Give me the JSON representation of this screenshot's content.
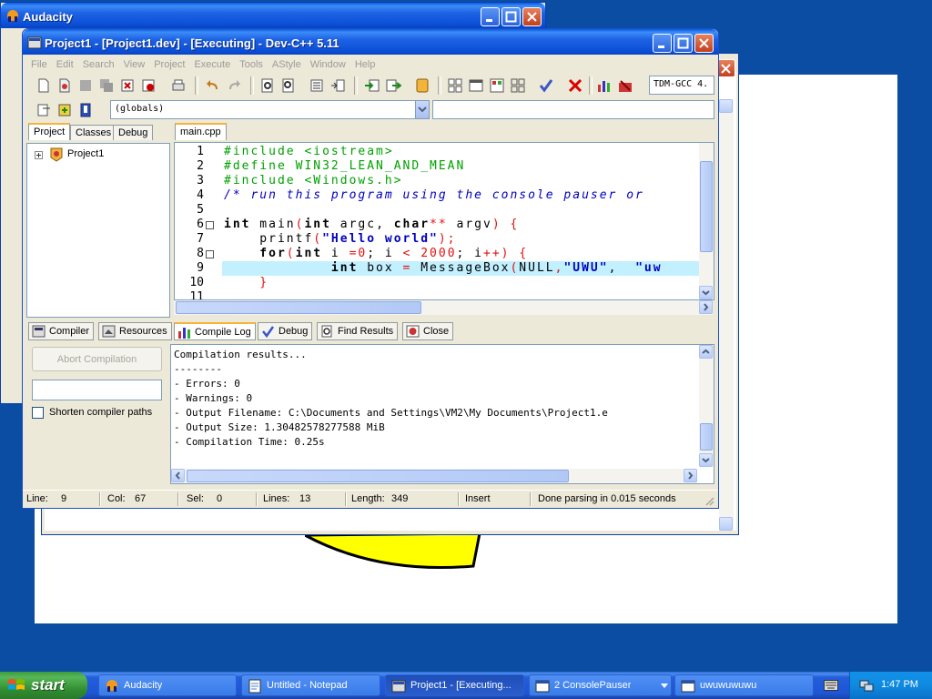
{
  "audacity": {
    "title": "Audacity"
  },
  "devcpp": {
    "title": "Project1 - [Project1.dev] - [Executing] - Dev-C++ 5.11",
    "menu": [
      "File",
      "Edit",
      "Search",
      "View",
      "Project",
      "Execute",
      "Tools",
      "AStyle",
      "Window",
      "Help"
    ],
    "compiler_combo": "TDM-GCC 4.",
    "scope_combo": "(globals)",
    "left_tabs": [
      "Project",
      "Classes",
      "Debug"
    ],
    "tree_root": "Project1",
    "editor_tab": "main.cpp",
    "line_numbers": [
      "1",
      "2",
      "3",
      "4",
      "5",
      "6",
      "7",
      "8",
      "9",
      "10",
      "11"
    ],
    "bottom_tabs": [
      "Compiler",
      "Resources",
      "Compile Log",
      "Debug",
      "Find Results",
      "Close"
    ],
    "abort_button": "Abort Compilation",
    "shorten_paths": "Shorten compiler paths",
    "log": [
      "Compilation results...",
      "--------",
      "- Errors: 0",
      "- Warnings: 0",
      "- Output Filename: C:\\Documents and Settings\\VM2\\My Documents\\Project1.e",
      "- Output Size: 1.30482578277588 MiB",
      "- Compilation Time: 0.25s"
    ],
    "status": {
      "line_label": "Line:",
      "line": "9",
      "col_label": "Col:",
      "col": "67",
      "sel_label": "Sel:",
      "sel": "0",
      "lines_label": "Lines:",
      "lines": "13",
      "length_label": "Length:",
      "length": "349",
      "mode": "Insert",
      "parse": "Done parsing in 0.015 seconds"
    }
  },
  "code": {
    "l1": "#include <iostream>",
    "l2": "#define WIN32_LEAN_AND_MEAN",
    "l3": "#include <Windows.h>",
    "l4": "/* run this program using the console pauser or",
    "l6a": "int",
    "l6b": " main",
    "l6c": "(",
    "l6d": "int",
    "l6e": " argc, ",
    "l6f": "char",
    "l6g": "**",
    "l6h": " argv",
    "l6i": ") {",
    "l7a": "    printf",
    "l7b": "(",
    "l7c": "\"Hello world\"",
    "l7d": ");",
    "l8a": "    for",
    "l8b": "(",
    "l8c": "int",
    "l8d": " i ",
    "l8e": "=",
    "l8f": "0",
    "l8g": "; i ",
    "l8h": "<",
    "l8i": " 2000",
    "l8j": "; i",
    "l8k": "++) {",
    "l9a": "            int",
    "l9b": " box ",
    "l9c": "=",
    "l9d": " MessageBox",
    "l9e": "(",
    "l9f": "NULL",
    "l9g": ",",
    "l9h": "\"UWU\"",
    "l9i": ",  ",
    "l9j": "\"uw",
    "l10": "    }"
  },
  "taskbar": {
    "start": "start",
    "tasks": [
      "Audacity",
      "Untitled - Notepad",
      "Project1 - [Executing...",
      "2 ConsolePauser",
      "uwuwuwuwu"
    ],
    "clock": "1:47 PM"
  },
  "colors": {
    "xp_blue": "#0a4da3",
    "title_blue": "#0b4fd8",
    "highlight": "#c3f0ff"
  }
}
